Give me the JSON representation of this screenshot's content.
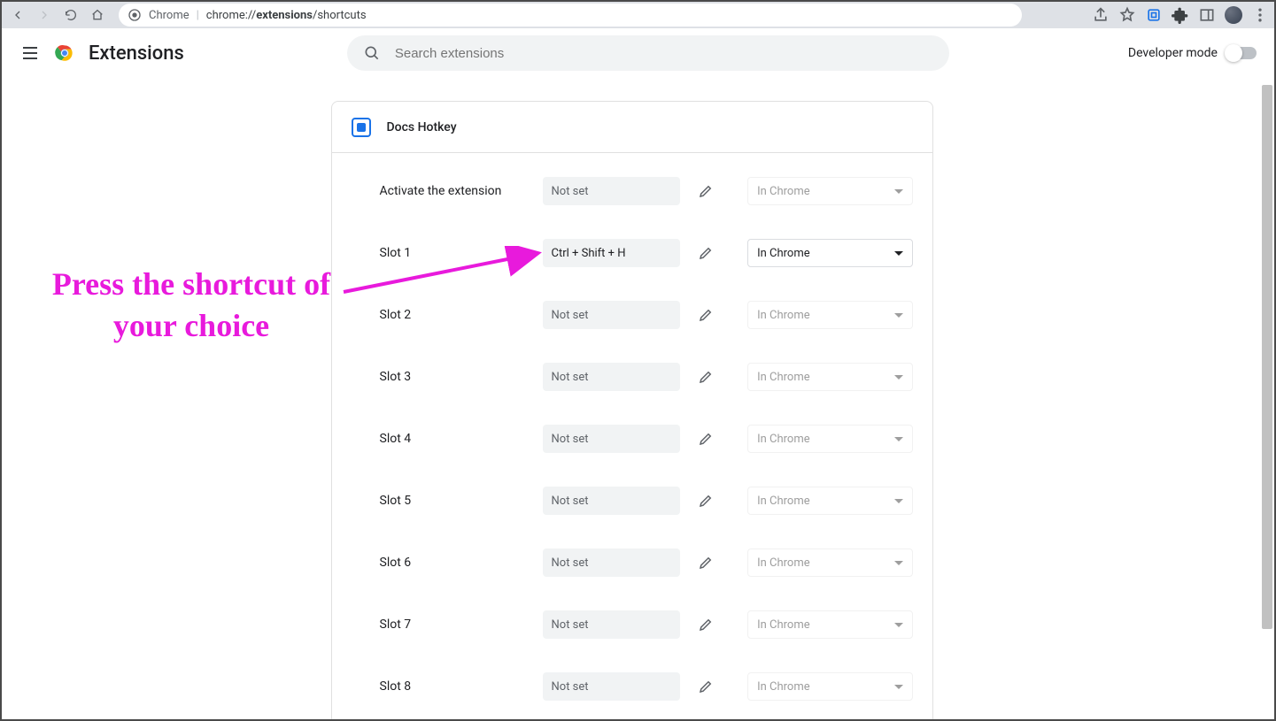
{
  "browser": {
    "omnibox_label": "Chrome",
    "url_prefix": "chrome://",
    "url_bold": "extensions",
    "url_rest": "/shortcuts"
  },
  "header": {
    "title": "Extensions",
    "search_placeholder": "Search extensions",
    "dev_mode_label": "Developer mode"
  },
  "extension": {
    "name": "Docs Hotkey",
    "rows": [
      {
        "label": "Activate the extension",
        "shortcut": "Not set",
        "set": false,
        "scope": "In Chrome",
        "scope_enabled": false
      },
      {
        "label": "Slot 1",
        "shortcut": "Ctrl + Shift + H",
        "set": true,
        "scope": "In Chrome",
        "scope_enabled": true
      },
      {
        "label": "Slot 2",
        "shortcut": "Not set",
        "set": false,
        "scope": "In Chrome",
        "scope_enabled": false
      },
      {
        "label": "Slot 3",
        "shortcut": "Not set",
        "set": false,
        "scope": "In Chrome",
        "scope_enabled": false
      },
      {
        "label": "Slot 4",
        "shortcut": "Not set",
        "set": false,
        "scope": "In Chrome",
        "scope_enabled": false
      },
      {
        "label": "Slot 5",
        "shortcut": "Not set",
        "set": false,
        "scope": "In Chrome",
        "scope_enabled": false
      },
      {
        "label": "Slot 6",
        "shortcut": "Not set",
        "set": false,
        "scope": "In Chrome",
        "scope_enabled": false
      },
      {
        "label": "Slot 7",
        "shortcut": "Not set",
        "set": false,
        "scope": "In Chrome",
        "scope_enabled": false
      },
      {
        "label": "Slot 8",
        "shortcut": "Not set",
        "set": false,
        "scope": "In Chrome",
        "scope_enabled": false
      }
    ]
  },
  "annotation": {
    "text": "Press the shortcut of your choice"
  }
}
